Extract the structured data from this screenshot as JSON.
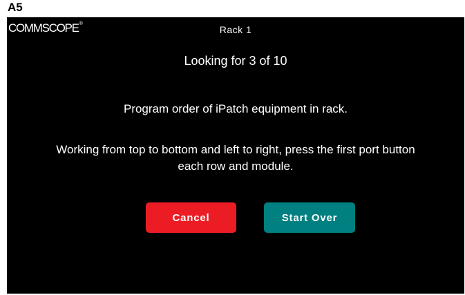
{
  "figure_label": "A5",
  "device": {
    "logo_text": "COMMSCOPE",
    "logo_mark": "®",
    "title": "Rack 1"
  },
  "main": {
    "status": "Looking for 3 of 10",
    "instruction": "Program order of iPatch equipment in rack.",
    "detail_line1": "Working from top to bottom and left to right, press the first port button",
    "detail_line2": "each row and module."
  },
  "buttons": {
    "cancel_label": "Cancel",
    "start_over_label": "Start Over"
  },
  "colors": {
    "screen_background": "#000000",
    "cancel_button": "#ec1c24",
    "start_over_button": "#008080",
    "text": "#ffffff"
  }
}
